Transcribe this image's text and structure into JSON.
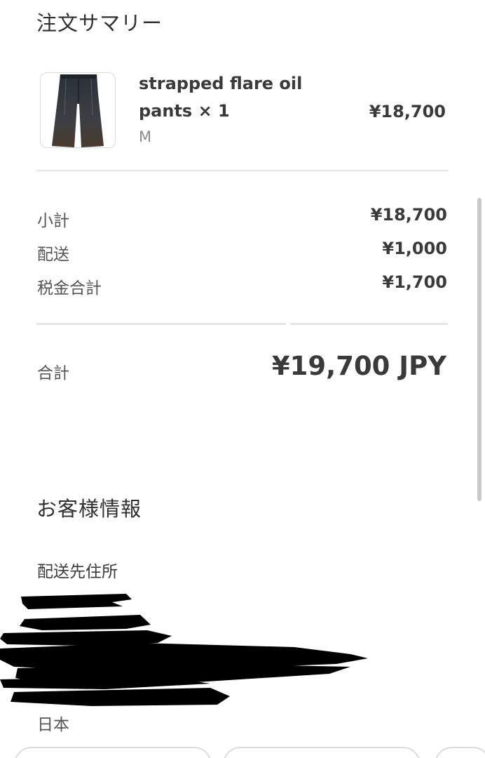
{
  "order_summary": {
    "title": "注文サマリー",
    "item": {
      "name": "strapped flare oil pants × 1",
      "variant": "M",
      "price": "¥18,700",
      "image_icon": "pants-thumbnail-icon"
    },
    "rows": [
      {
        "label": "小計",
        "value": "¥18,700"
      },
      {
        "label": "配送",
        "value": "¥1,000"
      },
      {
        "label": "税金合計",
        "value": "¥1,700"
      }
    ],
    "total": {
      "label": "合計",
      "value": "¥19,700 JPY"
    }
  },
  "customer_info": {
    "title": "お客様情報",
    "shipping_address_label": "配送先住所",
    "country": "日本"
  }
}
